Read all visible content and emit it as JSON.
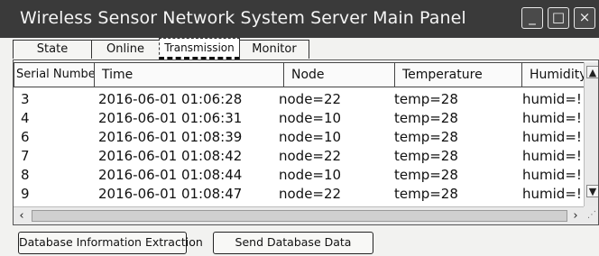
{
  "window": {
    "title": "Wireless Sensor Network System Server Main Panel",
    "minimize_glyph": "_",
    "maximize_glyph": "□",
    "close_glyph": "×"
  },
  "tabs": [
    {
      "label": "State",
      "active": false
    },
    {
      "label": "Online",
      "active": false
    },
    {
      "label": "Transmission",
      "active": true
    },
    {
      "label": "Monitor",
      "active": false
    }
  ],
  "table": {
    "columns": [
      "Serial Number",
      "Time",
      "Node",
      "Temperature",
      "Humidity"
    ],
    "rows": [
      [
        "3",
        "2016-06-01 01:06:28",
        "node=22",
        "temp=28",
        "humid=!"
      ],
      [
        "4",
        "2016-06-01 01:06:31",
        "node=10",
        "temp=28",
        "humid=!"
      ],
      [
        "6",
        "2016-06-01 01:08:39",
        "node=10",
        "temp=28",
        "humid=!"
      ],
      [
        "7",
        "2016-06-01 01:08:42",
        "node=22",
        "temp=28",
        "humid=!"
      ],
      [
        "8",
        "2016-06-01 01:08:44",
        "node=10",
        "temp=28",
        "humid=!"
      ],
      [
        "9",
        "2016-06-01 01:08:47",
        "node=22",
        "temp=28",
        "humid=!"
      ]
    ]
  },
  "buttons": {
    "extract": "Database Information Extraction",
    "send": "Send Database Data"
  },
  "colors": {
    "titlebar": "#3a3a3a",
    "background": "#f2f2f0"
  }
}
